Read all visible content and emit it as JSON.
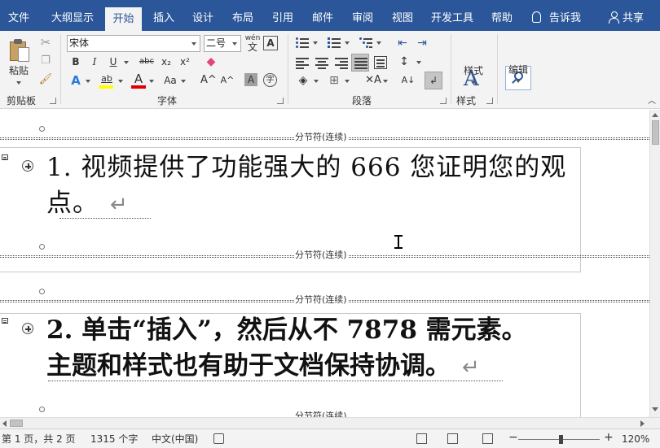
{
  "tabs": [
    {
      "label": "文件",
      "active": false
    },
    {
      "label": "大纲显示",
      "active": false
    },
    {
      "label": "开始",
      "active": true
    },
    {
      "label": "插入",
      "active": false
    },
    {
      "label": "设计",
      "active": false
    },
    {
      "label": "布局",
      "active": false
    },
    {
      "label": "引用",
      "active": false
    },
    {
      "label": "邮件",
      "active": false
    },
    {
      "label": "审阅",
      "active": false
    },
    {
      "label": "视图",
      "active": false
    },
    {
      "label": "开发工具",
      "active": false
    },
    {
      "label": "帮助",
      "active": false
    }
  ],
  "tell_me": "告诉我",
  "share": "共享",
  "ribbon": {
    "clipboard": {
      "paste": "粘贴",
      "group": "剪贴板"
    },
    "font": {
      "group": "字体",
      "font_name": "宋体",
      "font_size": "二号",
      "wen_top": "wén",
      "wen_bottom": "文",
      "bold": "B",
      "italic": "I",
      "underline": "U",
      "strike": "abc",
      "subscript": "x₂",
      "superscript": "x²",
      "text_effect": "A",
      "highlight": "ab",
      "font_color": "A",
      "change_case": "Aa",
      "grow": "A^",
      "shrink": "A^",
      "char_shading": "A",
      "enclose": "字"
    },
    "paragraph": {
      "group": "段落"
    },
    "styles": {
      "label": "样式",
      "group": "样式"
    },
    "editing": {
      "label": "编辑"
    }
  },
  "document": {
    "section_break": "分节符(连续)",
    "paragraphs": [
      {
        "line1": "1. 视频提供了功能强大的 666 您证明您的观",
        "line2": "点。"
      },
      {
        "line1": "2. 单击“插入”，然后从不 7878 需元素。",
        "line2": "主题和样式也有助于文档保持协调。"
      }
    ]
  },
  "statusbar": {
    "page": "第 1 页，共 2 页",
    "words": "1315 个字",
    "language": "中文(中国)",
    "zoom_minus": "−",
    "zoom_plus": "+",
    "zoom": "120%"
  },
  "colors": {
    "title_bar": "#2b579a",
    "ribbon_bg": "#f3f3f3",
    "highlight_yellow": "#ffff00",
    "font_color_red": "#e00000"
  }
}
